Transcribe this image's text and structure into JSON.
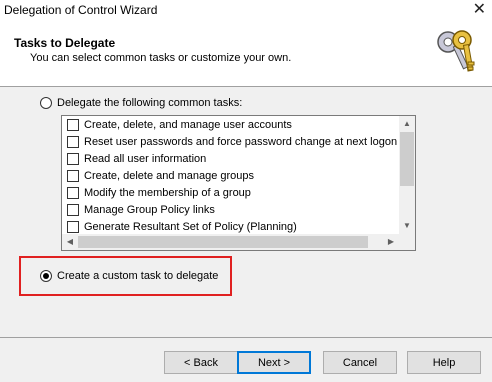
{
  "window": {
    "title": "Delegation of Control Wizard"
  },
  "header": {
    "title": "Tasks to Delegate",
    "subtitle": "You can select common tasks or customize your own."
  },
  "options": {
    "common": {
      "label": "Delegate the following common tasks:",
      "selected": false
    },
    "custom": {
      "label": "Create a custom task to delegate",
      "selected": true
    }
  },
  "tasks": [
    "Create, delete, and manage user accounts",
    "Reset user passwords and force password change at next logon",
    "Read all user information",
    "Create, delete and manage groups",
    "Modify the membership of a group",
    "Manage Group Policy links",
    "Generate Resultant Set of Policy (Planning)"
  ],
  "buttons": {
    "back": "< Back",
    "next": "Next >",
    "cancel": "Cancel",
    "help": "Help"
  },
  "colors": {
    "highlight": "#e02020",
    "accent": "#0078d7"
  }
}
